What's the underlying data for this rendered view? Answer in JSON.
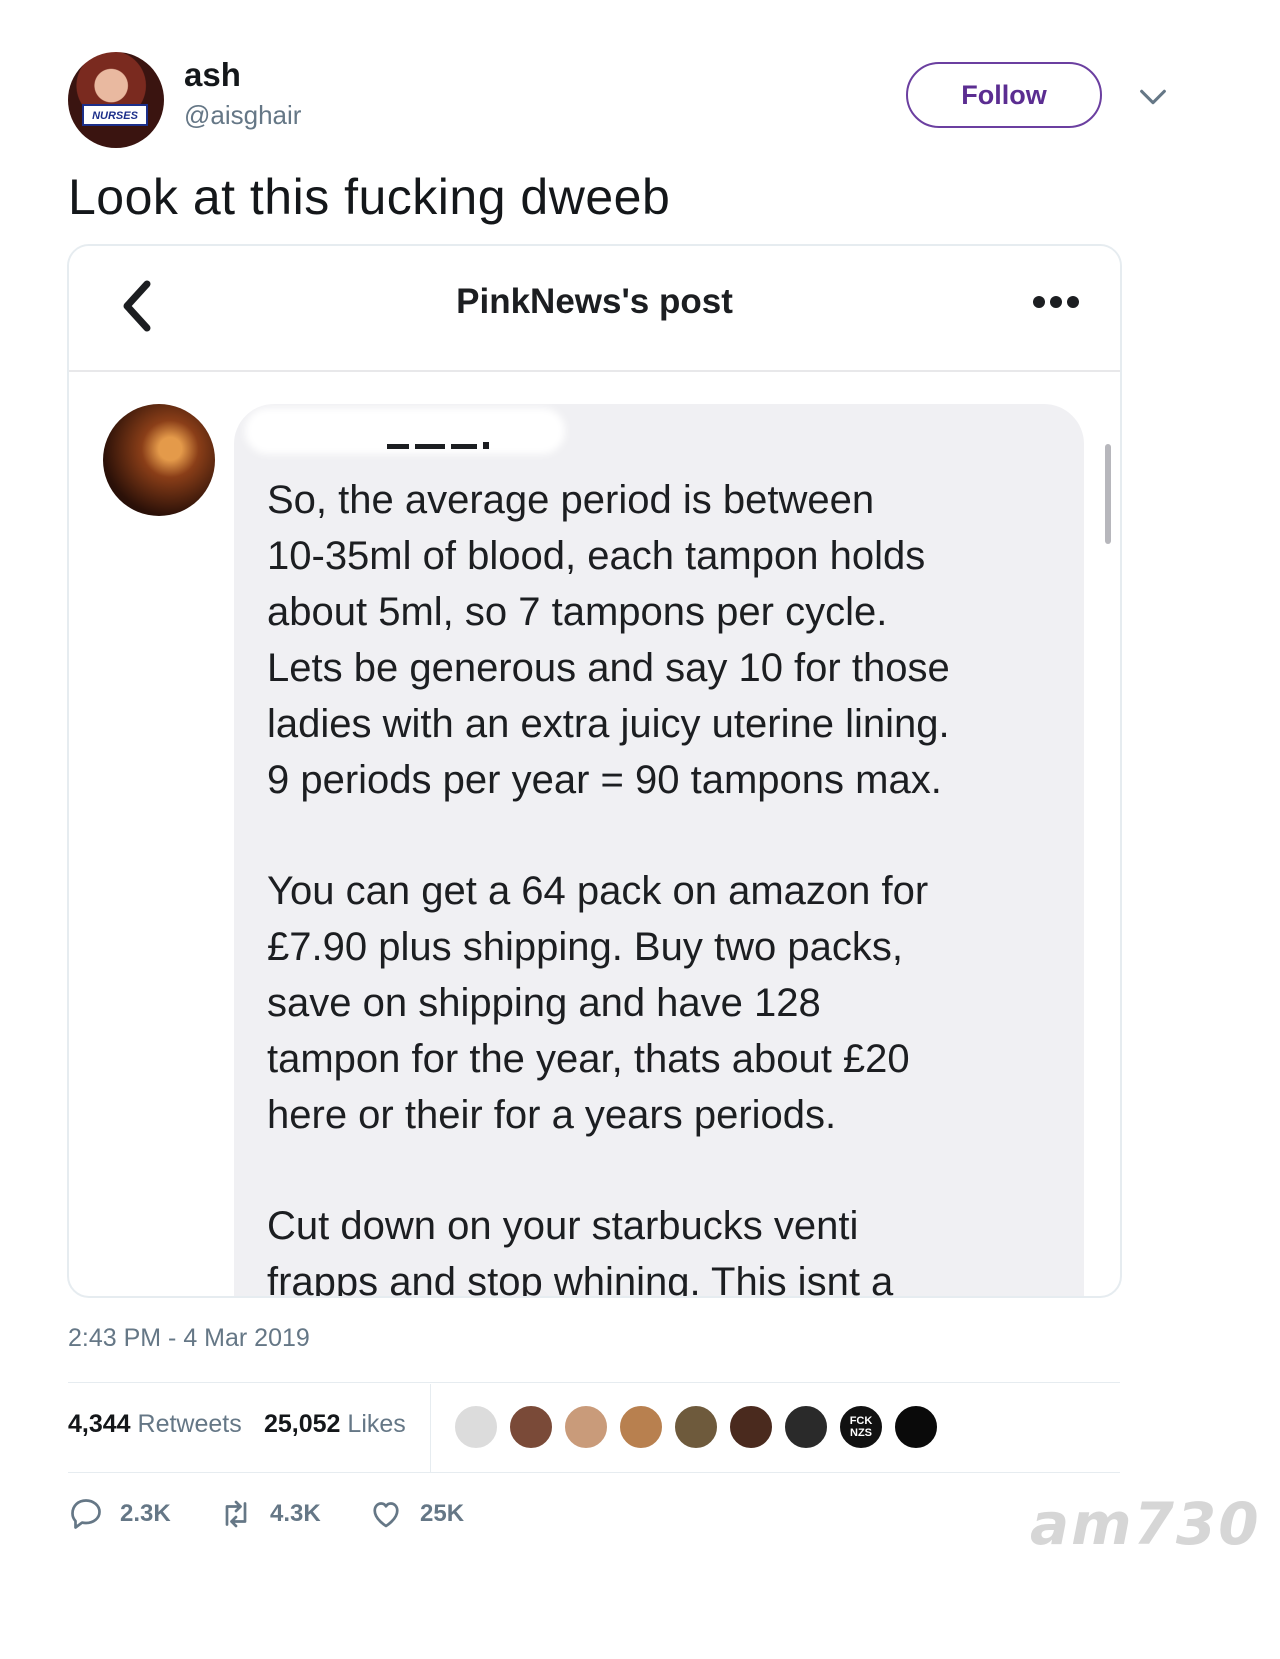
{
  "tweet": {
    "author": {
      "display_name": "ash",
      "handle": "@aisghair",
      "avatar_badge": "NURSES"
    },
    "follow_label": "Follow",
    "text": "Look at this fucking dweeb",
    "timestamp": "2:43 PM - 4 Mar 2019"
  },
  "embedded_post": {
    "title": "PinkNews's post",
    "paragraphs": [
      "So, the average period is between\n10-35ml of blood, each tampon holds\nabout 5ml, so 7 tampons per cycle.\nLets be generous and say 10 for those\nladies with an extra juicy uterine lining.\n9 periods per year = 90 tampons max.",
      "You can get a 64 pack on amazon for\n£7.90 plus shipping. Buy two packs,\nsave on shipping and have 128\ntampon for the year, thats about £20\nhere or their for a years periods.",
      "Cut down on your starbucks venti\nfrapps and stop whining. This isnt a"
    ]
  },
  "stats": {
    "retweets_count": "4,344",
    "retweets_label": "Retweets",
    "likes_count": "25,052",
    "likes_label": "Likes",
    "likers": [
      {
        "icon": "avatar",
        "color": "#dcdcdc"
      },
      {
        "icon": "avatar",
        "color": "#7a4a38"
      },
      {
        "icon": "avatar",
        "color": "#c99b7a"
      },
      {
        "icon": "avatar",
        "color": "#b8804f"
      },
      {
        "icon": "avatar",
        "color": "#6e5a3c"
      },
      {
        "icon": "avatar",
        "color": "#4a2a1e"
      },
      {
        "icon": "avatar",
        "color": "#2a2a2a"
      },
      {
        "icon": "avatar",
        "color": "#111111",
        "text": "FCK NZS"
      },
      {
        "icon": "avatar",
        "color": "#0a0a0a"
      }
    ]
  },
  "actions": {
    "replies": "2.3K",
    "retweets": "4.3K",
    "likes": "25K"
  },
  "watermark": "am730",
  "colors": {
    "accent": "#5b2d91",
    "secondary_text": "#657786",
    "bubble": "#f0f0f3"
  }
}
